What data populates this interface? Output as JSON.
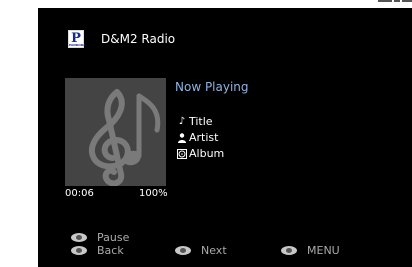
{
  "service": {
    "logo_letter": "P",
    "logo_small_text": "PANDORA",
    "name": "D&M2 Radio"
  },
  "album_art": {
    "icon": "music-notes-icon"
  },
  "now_playing": {
    "heading": "Now Playing",
    "title": "Title",
    "artist": "Artist",
    "album": "Album",
    "title_icon": "♪",
    "artist_icon": "👤",
    "album_icon": "⊠"
  },
  "status": {
    "time": "00:06",
    "volume": "100%"
  },
  "controls": {
    "pause_label": "Pause",
    "back_label": "Back",
    "next_label": "Next",
    "menu_label": "MENU"
  },
  "colors": {
    "screen_bg": "#000000",
    "accent_heading": "#8db4e0",
    "control_text": "#aaaaaa"
  }
}
